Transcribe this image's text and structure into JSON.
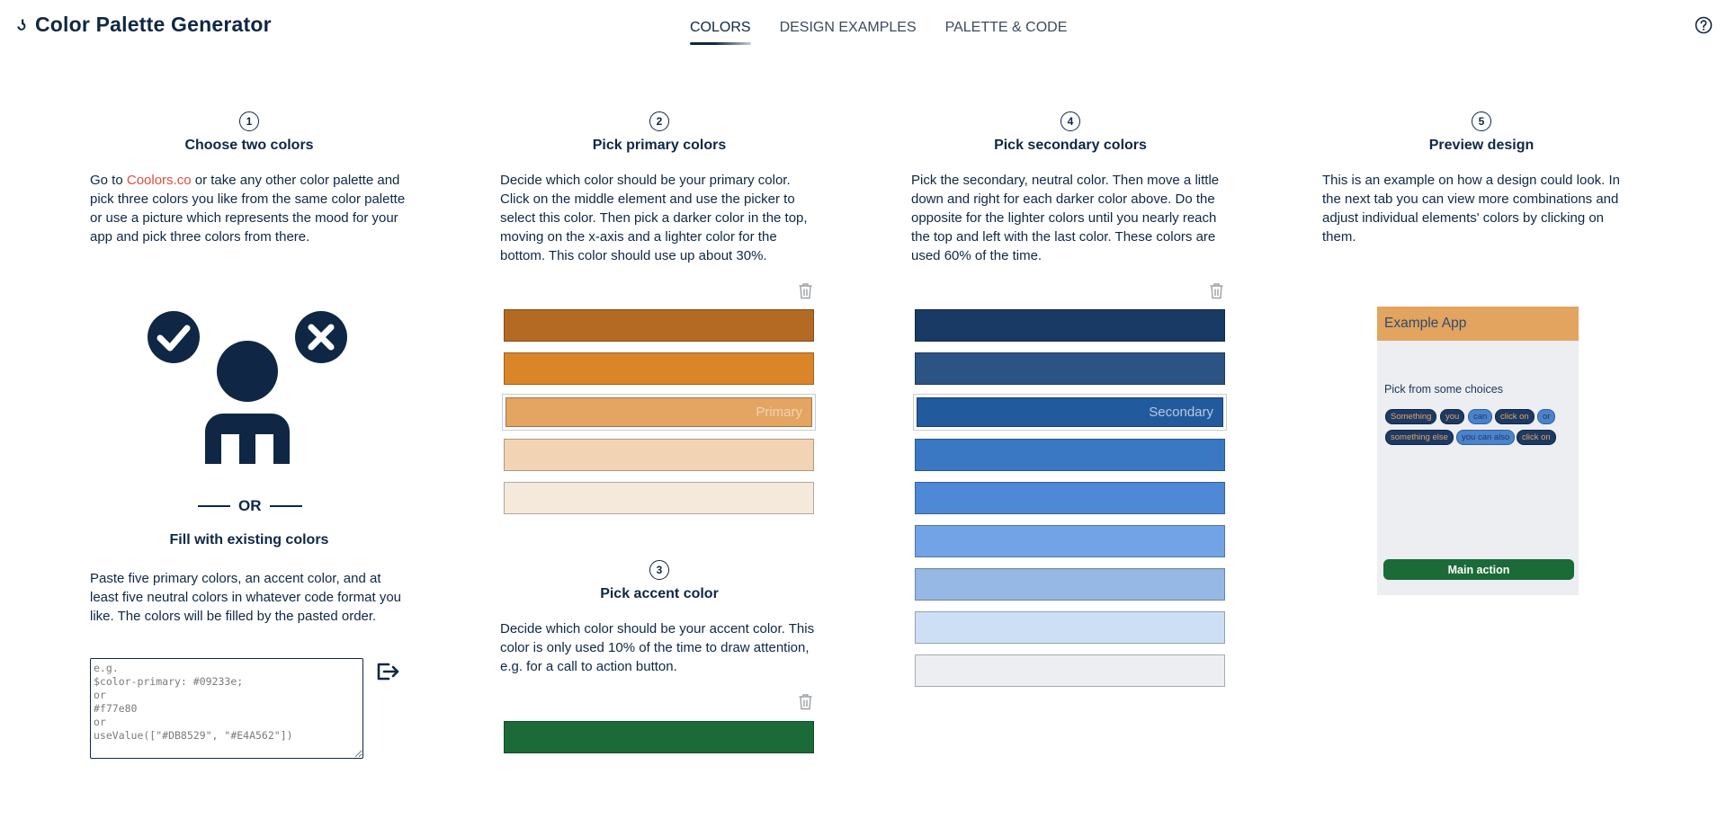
{
  "app": {
    "title": "Color Palette Generator",
    "nav_tabs": [
      {
        "label": "COLORS",
        "active": true
      },
      {
        "label": "DESIGN EXAMPLES",
        "active": false
      },
      {
        "label": "PALETTE & CODE",
        "active": false
      }
    ]
  },
  "step1": {
    "number": "1",
    "title": "Choose two colors",
    "desc_prefix": "Go to ",
    "link_text": "Coolors.co",
    "desc_suffix": " or take any other color palette and pick three colors you like from the same color palette or use a picture which represents the mood for your app and pick three colors from there.",
    "or_label": "OR",
    "fill_title": "Fill with existing colors",
    "fill_desc": "Paste five primary colors, an accent color, and at least five neutral colors in whatever code format you like. The colors will be filled by the pasted order.",
    "paste_placeholder": "e.g.\n$color-primary: #09233e;\nor\n#f77e80\nor\nuseValue([\"#DB8529\", \"#E4A562\"])"
  },
  "step2": {
    "number": "2",
    "title": "Pick primary colors",
    "desc": "Decide which color should be your primary color. Click on the middle element and use the picker to select this color. Then pick a darker color in the top, moving on the x-axis and a lighter color for the bottom. This color should use up about 30%.",
    "swatches": [
      "#b46a22",
      "#db8529",
      "#e4a562",
      "#f2d4b5",
      "#f5e9dc"
    ],
    "selected_label": "Primary"
  },
  "step3": {
    "number": "3",
    "title": "Pick accent color",
    "desc": "Decide which color should be your accent color. This color is only used 10% of the time to draw attention, e.g. for a call to action button.",
    "swatch": "#1a6b37"
  },
  "step4": {
    "number": "4",
    "title": "Pick secondary colors",
    "desc": "Pick the secondary, neutral color. Then move a little down and right for each darker color above. Do the opposite for the lighter colors until you nearly reach the top and left with the last color. These colors are used 60% of the time.",
    "swatches": [
      "#183a64",
      "#2b5384",
      "#225b9d",
      "#3b78c4",
      "#4e88d6",
      "#72a3e6",
      "#96b8e4",
      "#cddff4",
      "#eceef2"
    ],
    "selected_label": "Secondary"
  },
  "step5": {
    "number": "5",
    "title": "Preview design",
    "desc": "This is an example on how a design could look. In the next tab you can view more combinations and adjust individual elements' colors by clicking on them.",
    "preview": {
      "app_title": "Example App",
      "prompt": "Pick from some choices",
      "chips_row1": [
        {
          "label": "Something",
          "style": "dark"
        },
        {
          "label": "you",
          "style": "dark"
        },
        {
          "label": "can",
          "style": "light"
        },
        {
          "label": "click on",
          "style": "dark"
        },
        {
          "label": "or",
          "style": "light"
        }
      ],
      "chips_row2": [
        {
          "label": "something else",
          "style": "dark"
        },
        {
          "label": "you can also",
          "style": "light"
        },
        {
          "label": "click on",
          "style": "dark"
        }
      ],
      "main_action": "Main action"
    }
  },
  "colors": {
    "text": "#0f2744",
    "link": "#e14d3c",
    "icon_dark": "#0f2744",
    "trash": "#9aa0a6"
  }
}
